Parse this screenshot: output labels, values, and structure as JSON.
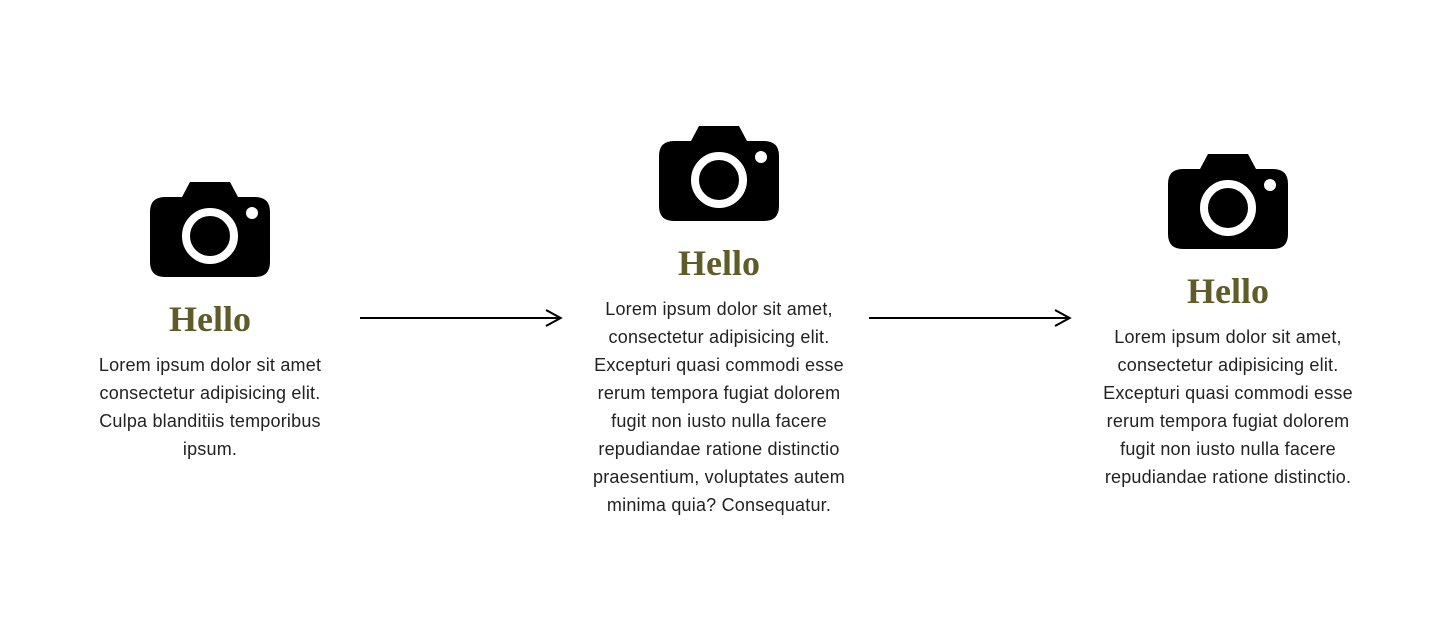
{
  "cards": [
    {
      "title": "Hello",
      "description": "Lorem ipsum dolor sit amet consectetur adipisicing elit. Culpa blanditiis temporibus ipsum."
    },
    {
      "title": "Hello",
      "description": "Lorem ipsum dolor sit amet, consectetur adipisicing elit. Excepturi quasi commodi esse rerum tempora fugiat dolorem fugit non iusto nulla facere repudiandae ratione distinctio praesentium, voluptates autem minima quia? Consequatur."
    },
    {
      "title": "Hello",
      "description": "Lorem ipsum dolor sit amet, consectetur adipisicing elit. Excepturi quasi commodi esse rerum tempora fugiat dolorem fugit non iusto nulla facere repudiandae ratione distinctio."
    }
  ],
  "colors": {
    "title": "#5f5c27",
    "text": "#222222",
    "icon": "#000000"
  }
}
